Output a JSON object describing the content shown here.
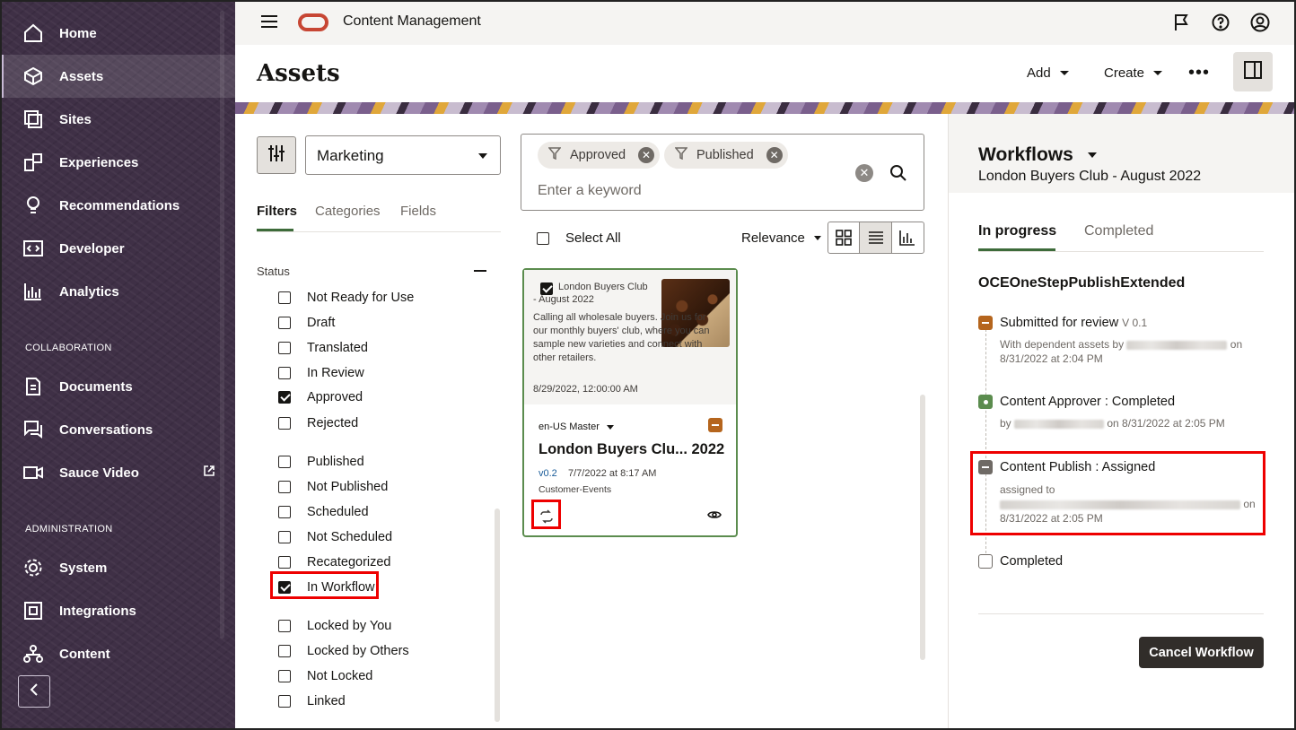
{
  "sidebar": {
    "items": [
      {
        "label": "Home",
        "icon": "home-icon"
      },
      {
        "label": "Assets",
        "icon": "cube-icon"
      },
      {
        "label": "Sites",
        "icon": "sites-icon"
      },
      {
        "label": "Experiences",
        "icon": "experiences-icon"
      },
      {
        "label": "Recommendations",
        "icon": "lightbulb-icon"
      },
      {
        "label": "Developer",
        "icon": "code-icon"
      },
      {
        "label": "Analytics",
        "icon": "analytics-icon"
      },
      {
        "label": "Documents",
        "icon": "document-icon"
      },
      {
        "label": "Conversations",
        "icon": "conversation-icon"
      },
      {
        "label": "Sauce Video",
        "icon": "video-icon"
      },
      {
        "label": "System",
        "icon": "gear-icon"
      },
      {
        "label": "Integrations",
        "icon": "integrations-icon"
      },
      {
        "label": "Content",
        "icon": "content-tree-icon"
      }
    ],
    "section_collaboration": "COLLABORATION",
    "section_administration": "ADMINISTRATION"
  },
  "topbar": {
    "app_title": "Content Management"
  },
  "header": {
    "title": "Assets",
    "add_label": "Add",
    "create_label": "Create",
    "more_label": "•••"
  },
  "filter_panel": {
    "repository": "Marketing",
    "tabs": [
      "Filters",
      "Categories",
      "Fields"
    ],
    "status_header": "Status",
    "options": [
      {
        "label": "Not Ready for Use",
        "checked": false
      },
      {
        "label": "Draft",
        "checked": false
      },
      {
        "label": "Translated",
        "checked": false
      },
      {
        "label": "In Review",
        "checked": false
      },
      {
        "label": "Approved",
        "checked": true
      },
      {
        "label": "Rejected",
        "checked": false
      },
      {
        "label": "Published",
        "checked": false
      },
      {
        "label": "Not Published",
        "checked": false
      },
      {
        "label": "Scheduled",
        "checked": false
      },
      {
        "label": "Not Scheduled",
        "checked": false
      },
      {
        "label": "Recategorized",
        "checked": false
      },
      {
        "label": "In Workflow",
        "checked": true
      },
      {
        "label": "Locked by You",
        "checked": false
      },
      {
        "label": "Locked by Others",
        "checked": false
      },
      {
        "label": "Not Locked",
        "checked": false
      },
      {
        "label": "Linked",
        "checked": false
      }
    ]
  },
  "search": {
    "chips": [
      "Approved",
      "Published"
    ],
    "placeholder": "Enter a keyword"
  },
  "toolbar": {
    "select_all": "Select All",
    "sort": "Relevance"
  },
  "asset_card": {
    "name_line1": "London Buyers Club",
    "name_line2": "- August 2022",
    "description": "Calling all wholesale buyers. Join us for our monthly buyers' club, where you can sample new varieties and connect with other retailers.",
    "date": "8/29/2022, 12:00:00 AM",
    "language": "en-US Master",
    "title": "London Buyers Clu... 2022",
    "version": "v0.2",
    "version_date": "7/7/2022 at 8:17 AM",
    "type": "Customer-Events"
  },
  "workflow": {
    "title": "Workflows",
    "subtitle": "London Buyers Club - August 2022",
    "tabs": [
      "In progress",
      "Completed"
    ],
    "name": "OCEOneStepPublishExtended",
    "steps": [
      {
        "title": "Submitted for review",
        "version": "V 0.1",
        "line1_pre": "With dependent assets by",
        "line1_post": "on",
        "line2": "8/31/2022 at 2:04 PM",
        "status": "pending"
      },
      {
        "title": "Content Approver : Completed",
        "line1_pre": "by",
        "line1_post": "on 8/31/2022 at 2:05 PM",
        "status": "done"
      },
      {
        "title": "Content Publish : Assigned",
        "line1_pre": "assigned to",
        "line1_post": "on",
        "line2": "8/31/2022 at 2:05 PM",
        "status": "assigned"
      },
      {
        "title": "Completed",
        "status": "empty"
      }
    ],
    "cancel_label": "Cancel Workflow"
  },
  "colors": {
    "sidebar_bg": "#3f3046",
    "accent_green": "#3d6b3a",
    "workflow_pending": "#b5651d",
    "highlight_red": "#e00000",
    "oracle_red": "#c74634"
  }
}
